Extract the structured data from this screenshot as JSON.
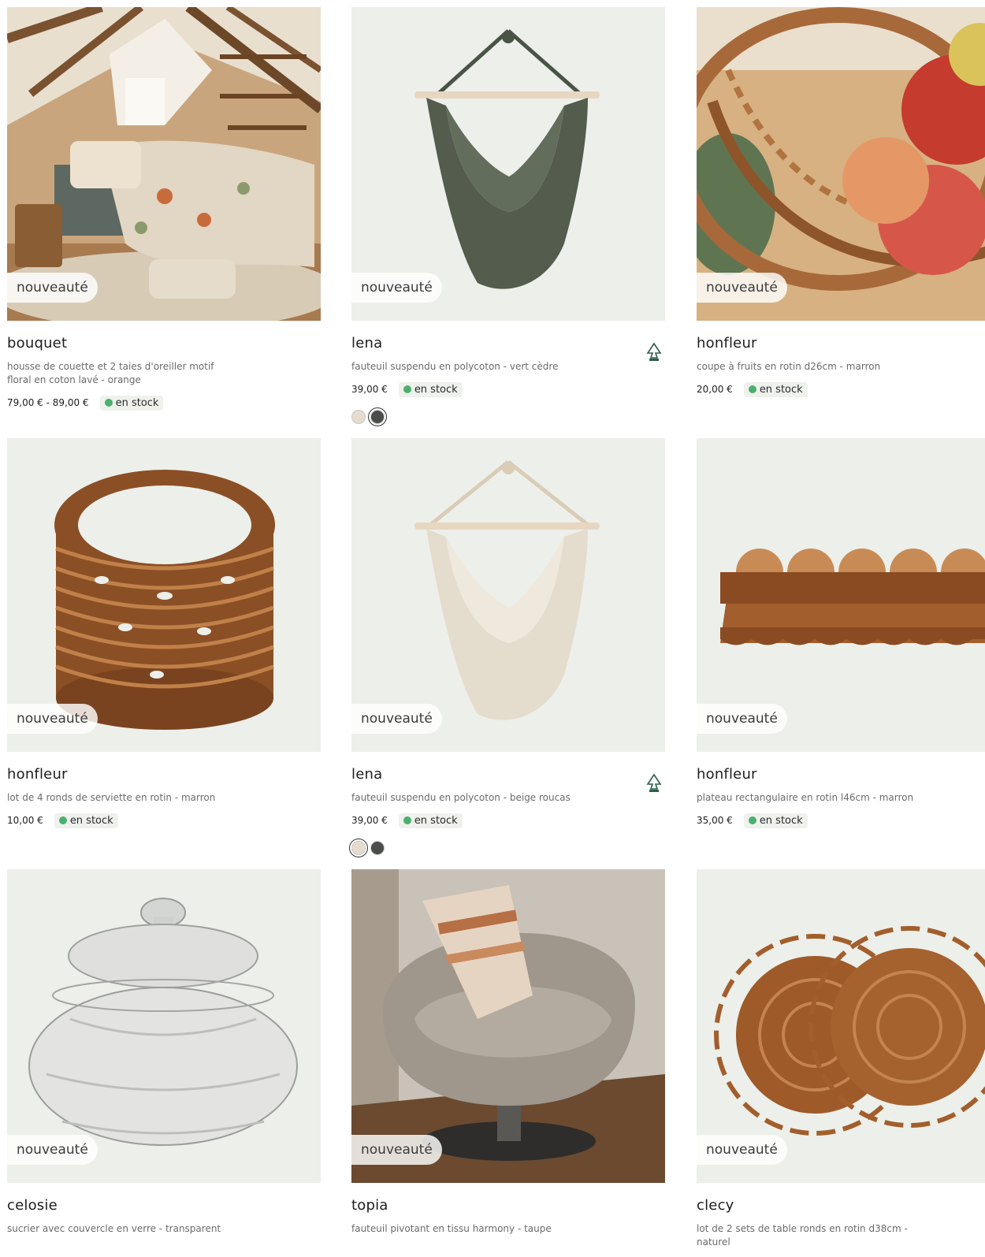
{
  "badge_label": "nouveauté",
  "colors": {
    "in_stock": "#4caf6e",
    "badge_bg": "#ffffff",
    "image_bg": "#edefea"
  },
  "products": [
    {
      "title": "bouquet",
      "desc": "housse de couette et 2 taies d'oreiller motif floral en coton lavé - orange",
      "price": "79,00 € - 89,00 €",
      "stock": "en stock",
      "icon": "bedroom-photo"
    },
    {
      "title": "lena",
      "desc": "fauteuil suspendu en polycoton - vert cèdre",
      "price": "39,00 €",
      "stock": "en stock",
      "fsc": true,
      "swatches": [
        "#e6dccd",
        "#4a4d49"
      ],
      "selected_swatch": 1,
      "icon": "hanging-chair-green"
    },
    {
      "title": "honfleur",
      "desc": "coupe à fruits en rotin d26cm - marron",
      "price": "20,00 €",
      "stock": "en stock",
      "icon": "rattan-fruit-bowl"
    },
    {
      "title": "honfleur",
      "desc": "lot de 4 ronds de serviette en rotin - marron",
      "price": "10,00 €",
      "stock": "en stock",
      "icon": "rattan-napkin-rings"
    },
    {
      "title": "lena",
      "desc": "fauteuil suspendu en polycoton - beige roucas",
      "price": "39,00 €",
      "stock": "en stock",
      "fsc": true,
      "swatches": [
        "#e6dccd",
        "#4a4d49"
      ],
      "selected_swatch": 0,
      "icon": "hanging-chair-beige"
    },
    {
      "title": "honfleur",
      "desc": "plateau rectangulaire en rotin l46cm - marron",
      "price": "35,00 €",
      "stock": "en stock",
      "icon": "rattan-tray"
    },
    {
      "title": "celosie",
      "desc": "sucrier avec couvercle en verre - transparent",
      "price": "",
      "stock": "",
      "icon": "glass-sugar-bowl"
    },
    {
      "title": "topia",
      "desc": "fauteuil pivotant en tissu harmony - taupe",
      "price": "",
      "stock": "",
      "icon": "swivel-armchair"
    },
    {
      "title": "clecy",
      "desc": "lot de 2 sets de table ronds en rotin d38cm - naturel",
      "price": "",
      "stock": "",
      "icon": "rattan-placemats"
    }
  ]
}
